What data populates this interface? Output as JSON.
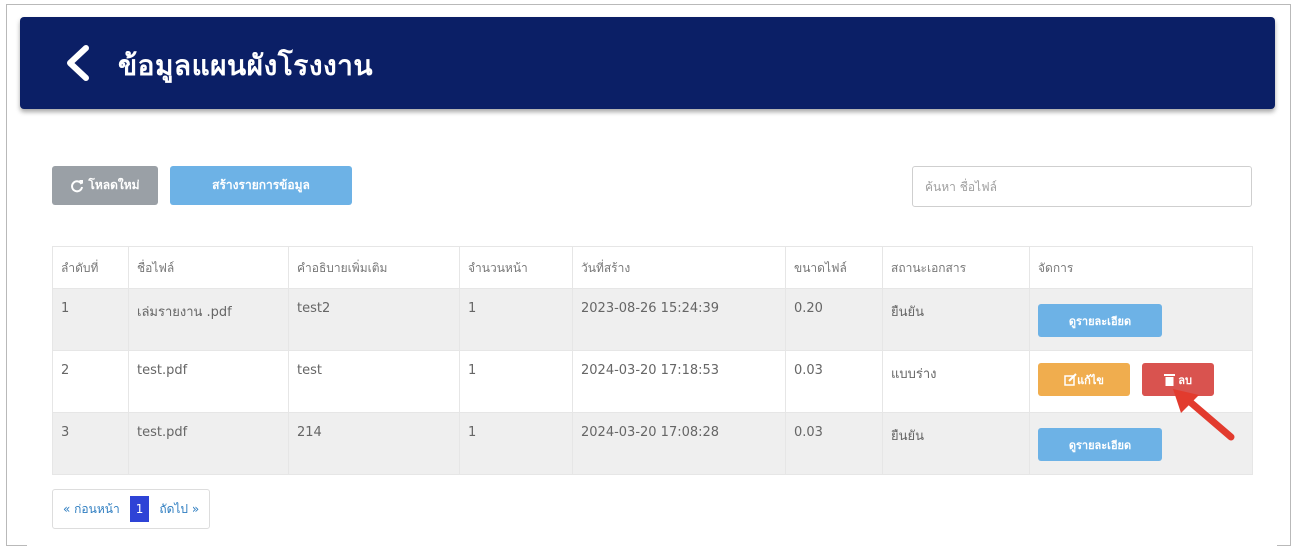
{
  "header": {
    "title": "ข้อมูลแผนผังโรงงาน",
    "background": "#0b1f66"
  },
  "toolbar": {
    "reload_label": "โหลดใหม่",
    "reload_icon": "refresh-icon",
    "create_label": "สร้างรายการข้อมูล",
    "search_placeholder": "ค้นหา ชื่อไฟล์"
  },
  "table": {
    "columns": [
      "ลำดับที่",
      "ชื่อไฟล์",
      "คำอธิบายเพิ่มเติม",
      "จำนวนหน้า",
      "วันที่สร้าง",
      "ขนาดไฟล์",
      "สถานะเอกสาร",
      "จัดการ"
    ],
    "rows": [
      {
        "no": "1",
        "filename": "เล่มรายงาน .pdf",
        "description": "test2",
        "pages": "1",
        "created": "2023-08-26 15:24:39",
        "size": "0.20",
        "status": "ยืนยัน",
        "action": "detail"
      },
      {
        "no": "2",
        "filename": "test.pdf",
        "description": "test",
        "pages": "1",
        "created": "2024-03-20 17:18:53",
        "size": "0.03",
        "status": "แบบร่าง",
        "action": "edit-delete"
      },
      {
        "no": "3",
        "filename": "test.pdf",
        "description": "214",
        "pages": "1",
        "created": "2024-03-20 17:08:28",
        "size": "0.03",
        "status": "ยืนยัน",
        "action": "detail"
      }
    ],
    "detail_label": "ดูรายละเอียด",
    "edit_label": "แก้ไข",
    "delete_label": "ลบ"
  },
  "pager": {
    "prev_label": "« ก่อนหน้า",
    "current": "1",
    "next_label": "ถัดไป »"
  },
  "colors": {
    "primary": "#6db2e6",
    "edit": "#f0ad4e",
    "delete": "#d9534f",
    "annotation_arrow": "#e23b2e"
  }
}
